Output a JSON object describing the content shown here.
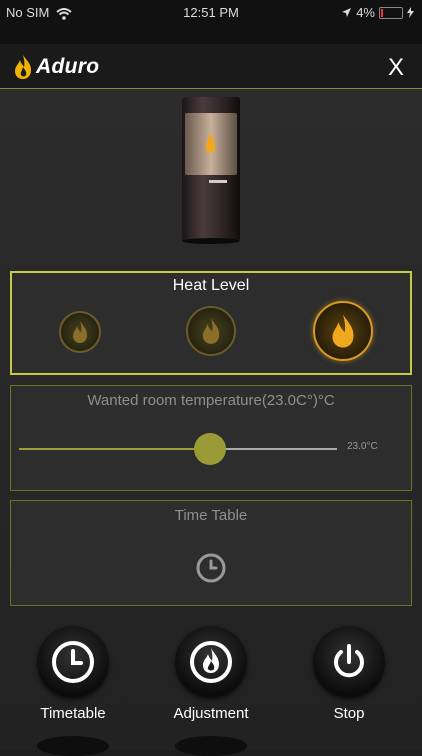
{
  "status_bar": {
    "carrier": "No SIM",
    "time": "12:51 PM",
    "battery": "4%"
  },
  "header": {
    "brand": "Aduro",
    "close_label": "X"
  },
  "heat_level": {
    "title": "Heat Level",
    "levels": [
      {
        "icon": "flame-icon",
        "active": false
      },
      {
        "icon": "flame-icon",
        "active": false
      },
      {
        "icon": "flame-icon",
        "active": true
      }
    ]
  },
  "temperature": {
    "title": "Wanted room temperature(23.0C°)°C",
    "value_label": "23.0°C",
    "slider_fraction": 0.6
  },
  "time_table": {
    "title": "Time Table",
    "icon": "clock-icon"
  },
  "bottom_nav": {
    "timetable": "Timetable",
    "adjustment": "Adjustment",
    "stop": "Stop"
  },
  "colors": {
    "accent": "#c9c948",
    "flame": "#f0a81e",
    "background": "#262626"
  }
}
